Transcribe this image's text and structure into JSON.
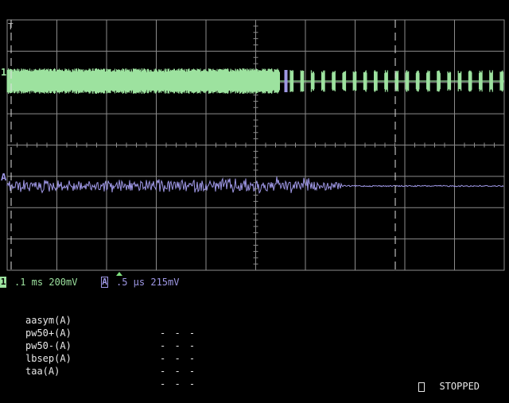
{
  "trace_colors": {
    "ch1": "#9de29f",
    "chA": "#9f98e6",
    "grid": "#8c8c8c",
    "cursor": "#e0e0e0"
  },
  "markers": {
    "ch1": "1",
    "chA": "A",
    "trigger": "T"
  },
  "status": {
    "ch1_badge": "1",
    "ch1_settings": ".1 ms 200mV",
    "chA_badge": "A",
    "chA_settings": ".5 µs 215mV"
  },
  "measurements": [
    {
      "name": "aasym(A)",
      "value": "- - -"
    },
    {
      "name": "pw50+(A)",
      "value": "- - -"
    },
    {
      "name": "pw50-(A)",
      "value": "- - -"
    },
    {
      "name": "lbsep(A)",
      "value": "- - -"
    },
    {
      "name": "taa(A)",
      "value": "- - -"
    }
  ],
  "acquisition_state": "STOPPED"
}
